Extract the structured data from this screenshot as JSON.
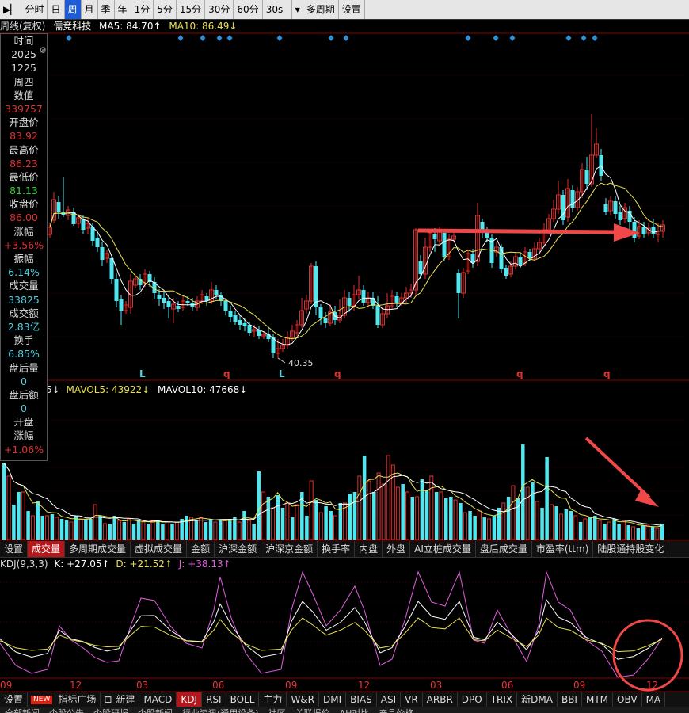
{
  "toolbar": {
    "items": [
      "分时",
      "日",
      "周",
      "月",
      "季",
      "年",
      "1分",
      "5分",
      "15分",
      "30分",
      "60分",
      "30s",
      "多周期",
      "设置"
    ],
    "active": 2
  },
  "info": {
    "period": "周线(复权)",
    "stock": "儒竞科技",
    "ma5": "MA5: 84.70↑",
    "ma10": "MA10: 86.49↓"
  },
  "sidebar": {
    "rows": [
      {
        "label": "时间"
      },
      {
        "value": "2025",
        "color": "#ddd"
      },
      {
        "value": "1225",
        "color": "#ddd"
      },
      {
        "value": "周四",
        "color": "#ddd"
      },
      {
        "label": "数值"
      },
      {
        "value": "339757",
        "color": "#e03030"
      },
      {
        "label": "开盘价"
      },
      {
        "value": "83.92",
        "color": "#e03030"
      },
      {
        "label": "最高价"
      },
      {
        "value": "86.23",
        "color": "#e03030"
      },
      {
        "label": "最低价"
      },
      {
        "value": "81.13",
        "color": "#32d232"
      },
      {
        "label": "收盘价"
      },
      {
        "value": "86.00",
        "color": "#e03030"
      },
      {
        "label": "涨幅"
      },
      {
        "value": "+3.56%",
        "color": "#e03030"
      },
      {
        "label": "振幅"
      },
      {
        "value": "6.14%",
        "color": "#4fd0e0"
      },
      {
        "label": "成交量"
      },
      {
        "value": "33825",
        "color": "#4fd0e0"
      },
      {
        "label": "成交额"
      },
      {
        "value": "2.83亿",
        "color": "#4fd0e0"
      },
      {
        "label": "换手"
      },
      {
        "value": "6.85%",
        "color": "#4fd0e0"
      },
      {
        "label": "盘后量"
      },
      {
        "value": "0",
        "color": "#4fd0e0"
      },
      {
        "label": "盘后额"
      },
      {
        "value": "0",
        "color": "#4fd0e0"
      },
      {
        "label": "开盘"
      },
      {
        "label": "涨幅"
      },
      {
        "value": "+1.06%",
        "color": "#e03030"
      }
    ]
  },
  "price_chart": {
    "low_label": "40.35",
    "markers": [
      "L",
      "q",
      "L",
      "q",
      "q",
      "q"
    ]
  },
  "volume": {
    "prefix": "5↓",
    "mavol5": "MAVOL5: 43922↓",
    "mavol10": "MAVOL10: 47668↓"
  },
  "tabs": {
    "items": [
      "设置",
      "成交量",
      "多周期成交量",
      "虚拟成交量",
      "金额",
      "沪深金额",
      "沪深京金额",
      "换手率",
      "内盘",
      "外盘",
      "AI立桩成交量",
      "盘后成交量",
      "市盈率(ttm)",
      "陆股通持股变化"
    ],
    "active": 1
  },
  "kdj": {
    "name": "KDJ(9,3,3)",
    "k": "K: +27.05↑",
    "d": "D: +21.52↑",
    "j": "J: +38.13↑"
  },
  "xaxis": [
    "09",
    "12",
    "03",
    "06",
    "09",
    "12",
    "03",
    "06",
    "09",
    "12"
  ],
  "bottom_tabs": {
    "items": [
      "设置",
      "NEW",
      "指标广场",
      "新建",
      "MACD",
      "KDJ",
      "RSI",
      "BOLL",
      "主力",
      "W&R",
      "DMI",
      "BIAS",
      "ASI",
      "VR",
      "ARBR",
      "DPO",
      "TRIX",
      "新DMA",
      "BBI",
      "MTM",
      "OBV",
      "MA"
    ],
    "active": 5
  },
  "bottom_strip": [
    "全部新闻",
    "个股公告",
    "个股研报",
    "个股新闻",
    "行业资讯(通用设备)",
    "社区",
    "关联报价",
    "AH对比",
    "产品价格"
  ],
  "colors": {
    "up": "#e03030",
    "down": "#50e8f0",
    "ma5": "#ffffff",
    "ma10": "#e8e050",
    "arrow": "#f04848",
    "k": "#ffffff",
    "d": "#e8e050",
    "j": "#e060e0"
  }
}
